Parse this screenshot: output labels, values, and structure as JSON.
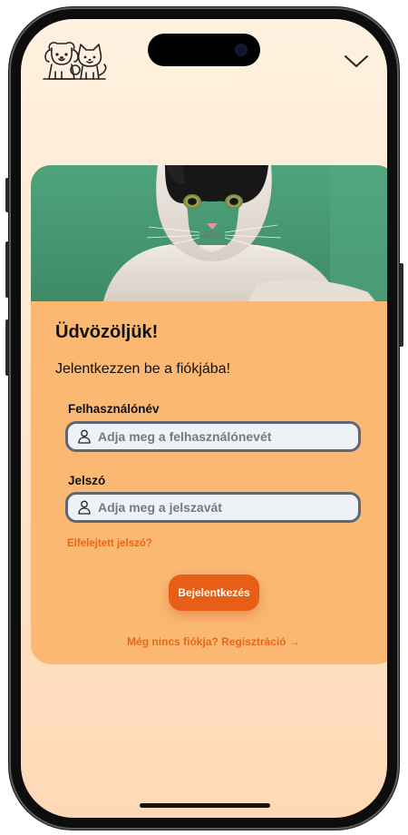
{
  "header": {
    "logo_icon": "dog-and-cat-logo-icon",
    "menu_icon": "chevron-down-icon"
  },
  "hero": {
    "image": "cat-photo"
  },
  "login": {
    "welcome": "Üdvözöljük!",
    "subtitle": "Jelentkezzen be a fiókjába!",
    "username_label": "Felhasználónév",
    "username_placeholder": "Adja meg a felhasználónevét",
    "username_value": "",
    "password_label": "Jelszó",
    "password_placeholder": "Adja meg a jelszavát",
    "password_value": "",
    "forgot_link": "Elfelejtett jelszó?",
    "submit_label": "Bejelentkezés",
    "register_link": "Még nincs fiókja? Regisztráció →"
  },
  "colors": {
    "accent": "#e85e16",
    "card": "#fbb872",
    "background": "#fff1e0",
    "link": "#e8661a"
  }
}
